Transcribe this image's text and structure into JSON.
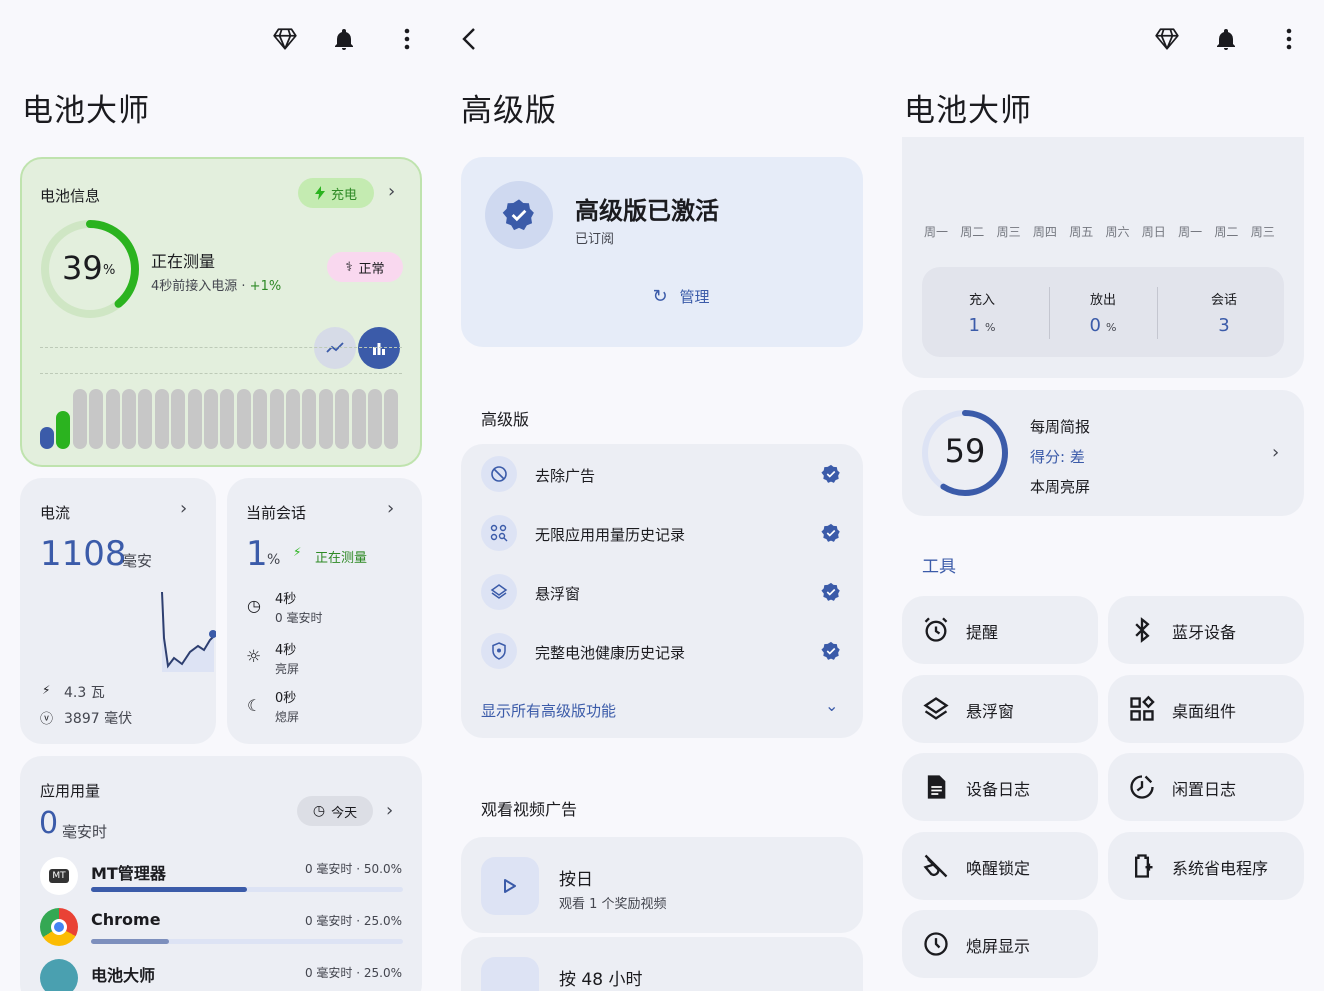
{
  "left": {
    "title": "电池大师",
    "battery_card": {
      "label": "电池信息",
      "charge_chip": "充电",
      "percent": "39",
      "percent_unit": "%",
      "level": 0.39,
      "status": "正在测量",
      "detail_prefix": "4秒前接入电源 · ",
      "detail_delta": "+1%",
      "state_chip": "正常"
    },
    "current_card": {
      "label": "电流",
      "value": "1108",
      "unit": "毫安",
      "power": "4.3 瓦",
      "voltage": "3897 毫伏"
    },
    "session_card": {
      "label": "当前会话",
      "value": "1",
      "unit": "%",
      "status": "正在测量",
      "rows": [
        {
          "line1": "4秒",
          "line2": "0 毫安时",
          "icon": "clock-icon"
        },
        {
          "line1": "4秒",
          "line2": "亮屏",
          "icon": "sun-icon"
        },
        {
          "line1": "0秒",
          "line2": "熄屏",
          "icon": "moon-icon"
        }
      ]
    },
    "usage_card": {
      "label": "应用用量",
      "value": "0",
      "unit": "毫安时",
      "chip": "今天",
      "apps": [
        {
          "name": "MT管理器",
          "stat": "0 毫安时 · 50.0%",
          "share": 0.5
        },
        {
          "name": "Chrome",
          "stat": "0 毫安时 · 25.0%",
          "share": 0.25
        },
        {
          "name": "电池大师",
          "stat": "0 毫安时 · 25.0%",
          "share": 0.25
        }
      ]
    }
  },
  "middle": {
    "title": "高级版",
    "hero": {
      "title": "高级版已激活",
      "subtitle": "已订阅",
      "manage": "管理"
    },
    "section_label": "高级版",
    "features": [
      {
        "label": "去除广告",
        "icon": "block-icon"
      },
      {
        "label": "无限应用用量历史记录",
        "icon": "apps-icon"
      },
      {
        "label": "悬浮窗",
        "icon": "layers-icon"
      },
      {
        "label": "完整电池健康历史记录",
        "icon": "shield-icon"
      }
    ],
    "show_all": "显示所有高级版功能",
    "ads_label": "观看视频广告",
    "ad_items": [
      {
        "title": "按日",
        "subtitle": "观看 1 个奖励视频"
      },
      {
        "title": "按 48 小时",
        "subtitle": ""
      }
    ]
  },
  "right": {
    "title": "电池大师",
    "days": [
      "周一",
      "周二",
      "周三",
      "周四",
      "周五",
      "周六",
      "周日",
      "周一",
      "周二",
      "周三"
    ],
    "stats": [
      {
        "label": "充入",
        "value": "1",
        "unit": "%"
      },
      {
        "label": "放出",
        "value": "0",
        "unit": "%"
      },
      {
        "label": "会话",
        "value": "3",
        "unit": ""
      }
    ],
    "weekly": {
      "score": "59",
      "score_level": 0.59,
      "title": "每周简报",
      "grade": "得分: 差",
      "note": "本周亮屏"
    },
    "tools_label": "工具",
    "tools": [
      {
        "label": "提醒",
        "icon": "alarm-icon"
      },
      {
        "label": "蓝牙设备",
        "icon": "bluetooth-icon"
      },
      {
        "label": "悬浮窗",
        "icon": "layers-icon"
      },
      {
        "label": "桌面组件",
        "icon": "widgets-icon"
      },
      {
        "label": "设备日志",
        "icon": "document-icon"
      },
      {
        "label": "闲置日志",
        "icon": "idle-icon"
      },
      {
        "label": "唤醒锁定",
        "icon": "wakelock-icon"
      },
      {
        "label": "系统省电程序",
        "icon": "battery-saver-icon"
      },
      {
        "label": "熄屏显示",
        "icon": "clock-icon"
      }
    ]
  },
  "colors": {
    "accent": "#3b5ba9",
    "green": "#2bb31f",
    "card": "#eceef4",
    "green_card": "#e3efdd"
  }
}
